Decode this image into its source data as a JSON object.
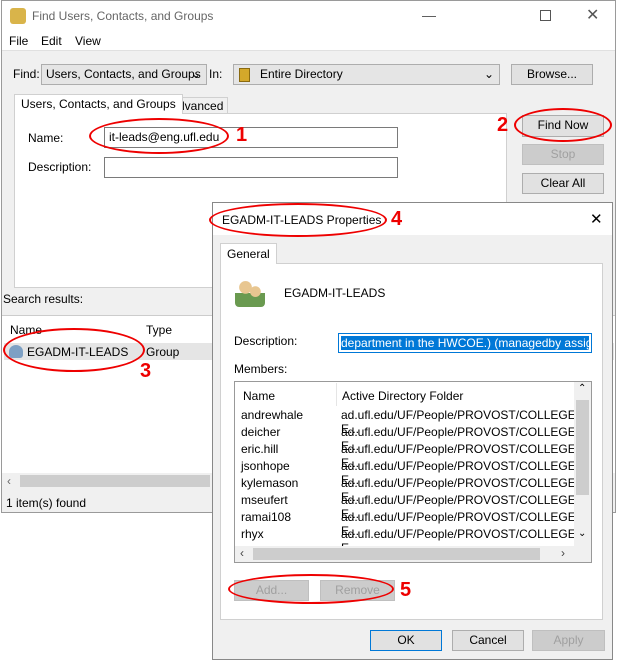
{
  "main": {
    "title": "Find Users, Contacts, and Groups",
    "menu": [
      "File",
      "Edit",
      "View"
    ],
    "find_label": "Find:",
    "find_value": "Users, Contacts, and Groups",
    "in_label": "In:",
    "in_value": "Entire Directory",
    "browse": "Browse...",
    "tabs": [
      "Users, Contacts, and Groups",
      "Advanced"
    ],
    "name_label": "Name:",
    "name_value": "it-leads@eng.ufl.edu",
    "desc_label": "Description:",
    "desc_value": "",
    "find_now": "Find Now",
    "stop": "Stop",
    "clear_all": "Clear All",
    "results_label": "Search results:",
    "columns": [
      "Name",
      "Type"
    ],
    "results": [
      {
        "name": "EGADM-IT-LEADS",
        "type": "Group"
      }
    ],
    "status": "1 item(s) found"
  },
  "dialog": {
    "title": "EGADM-IT-LEADS Properties",
    "tab": "General",
    "group_name": "EGADM-IT-LEADS",
    "desc_label": "Description:",
    "desc_value": "department in the HWCOE.) (managedby assigned)",
    "members_label": "Members:",
    "columns": [
      "Name",
      "Active Directory Folder"
    ],
    "members": [
      {
        "name": "andrewhale",
        "folder": "ad.ufl.edu/UF/People/PROVOST/COLLEGE-E..."
      },
      {
        "name": "deicher",
        "folder": "ad.ufl.edu/UF/People/PROVOST/COLLEGE-E..."
      },
      {
        "name": "eric.hill",
        "folder": "ad.ufl.edu/UF/People/PROVOST/COLLEGE-E..."
      },
      {
        "name": "jsonhope",
        "folder": "ad.ufl.edu/UF/People/PROVOST/COLLEGE-E..."
      },
      {
        "name": "kylemason",
        "folder": "ad.ufl.edu/UF/People/PROVOST/COLLEGE-E..."
      },
      {
        "name": "mseufert",
        "folder": "ad.ufl.edu/UF/People/PROVOST/COLLEGE-E..."
      },
      {
        "name": "ramai108",
        "folder": "ad.ufl.edu/UF/People/PROVOST/COLLEGE-E..."
      },
      {
        "name": "rhyx",
        "folder": "ad.ufl.edu/UF/People/PROVOST/COLLEGE-E..."
      }
    ],
    "add": "Add...",
    "remove": "Remove",
    "ok": "OK",
    "cancel": "Cancel",
    "apply": "Apply"
  },
  "annotations": [
    "1",
    "2",
    "3",
    "4",
    "5"
  ],
  "colors": {
    "annotation": "#ee0000",
    "selection": "#0078d7"
  }
}
